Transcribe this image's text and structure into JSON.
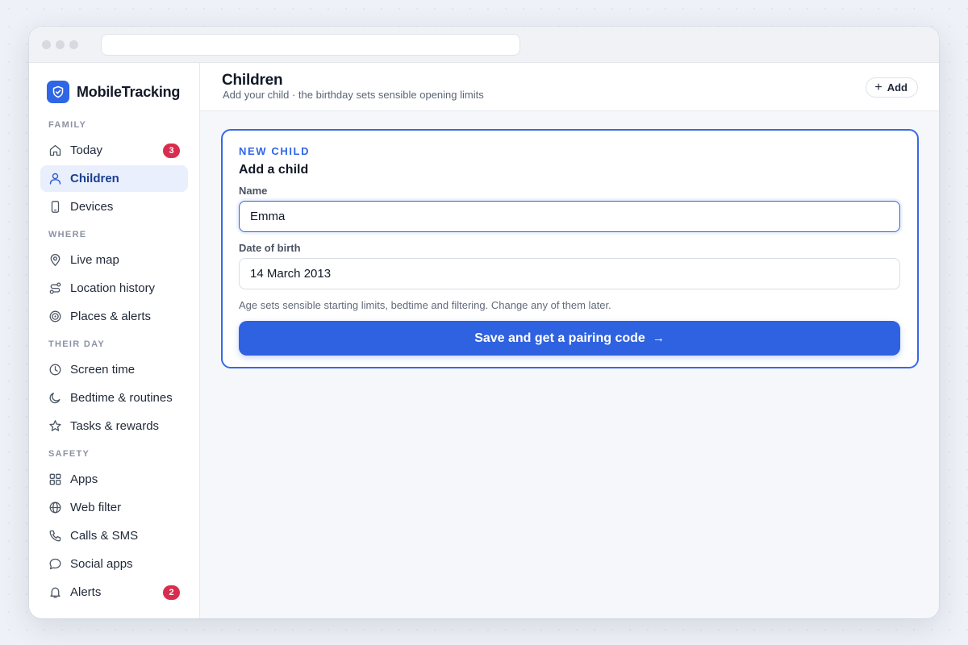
{
  "app": {
    "name": "MobileTracking"
  },
  "sidebar": {
    "sections": [
      {
        "label": "FAMILY",
        "items": [
          {
            "label": "Today",
            "icon": "home-icon",
            "badge": "3"
          },
          {
            "label": "Children",
            "icon": "user-icon",
            "active": true
          },
          {
            "label": "Devices",
            "icon": "phone-icon"
          }
        ]
      },
      {
        "label": "WHERE",
        "items": [
          {
            "label": "Live map",
            "icon": "map-pin-icon"
          },
          {
            "label": "Location history",
            "icon": "route-icon"
          },
          {
            "label": "Places & alerts",
            "icon": "target-icon"
          }
        ]
      },
      {
        "label": "THEIR DAY",
        "items": [
          {
            "label": "Screen time",
            "icon": "clock-icon"
          },
          {
            "label": "Bedtime & routines",
            "icon": "moon-icon"
          },
          {
            "label": "Tasks & rewards",
            "icon": "star-icon"
          }
        ]
      },
      {
        "label": "SAFETY",
        "items": [
          {
            "label": "Apps",
            "icon": "grid-icon"
          },
          {
            "label": "Web filter",
            "icon": "globe-icon"
          },
          {
            "label": "Calls & SMS",
            "icon": "call-icon"
          },
          {
            "label": "Social apps",
            "icon": "chat-icon"
          },
          {
            "label": "Alerts",
            "icon": "bell-icon",
            "badge": "2"
          }
        ]
      }
    ]
  },
  "header": {
    "title": "Children",
    "subtitle": "Add your child · the birthday sets sensible opening limits",
    "add_label": "Add"
  },
  "card": {
    "eyebrow": "NEW CHILD",
    "title": "Add a child",
    "name_label": "Name",
    "name_value": "Emma",
    "dob_label": "Date of birth",
    "dob_value": "14 March 2013",
    "hint": "Age sets sensible starting limits, bedtime and filtering. Change any of them later.",
    "submit_label": "Save and get a pairing code"
  },
  "colors": {
    "accent": "#2f66e6",
    "badge": "#d92d4d",
    "active_bg": "#e9effd"
  }
}
